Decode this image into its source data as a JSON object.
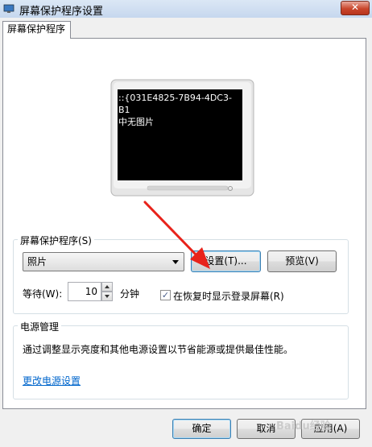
{
  "window": {
    "title": "屏幕保护程序设置",
    "close_glyph": "✕"
  },
  "tabs": [
    {
      "label": "屏幕保护程序"
    }
  ],
  "preview": {
    "screen_text": "::{031E4825-7B94-4DC3-B1\n中无图片"
  },
  "screensaver_group": {
    "label": "屏幕保护程序(S)",
    "selected": "照片",
    "settings_button": "设置(T)...",
    "preview_button": "预览(V)",
    "wait_label": "等待(W):",
    "wait_value": "10",
    "wait_unit": "分钟",
    "resume_checkbox": {
      "label": "在恢复时显示登录屏幕(R)",
      "checked": true
    }
  },
  "power_group": {
    "label": "电源管理",
    "description": "通过调整显示亮度和其他电源设置以节省能源或提供最佳性能。",
    "link": "更改电源设置"
  },
  "footer": {
    "ok": "确定",
    "cancel": "取消",
    "apply": "应用(A)"
  },
  "watermark": "Baidu经验",
  "colors": {
    "annotation_arrow": "#e8231b",
    "link": "#0066cc"
  }
}
